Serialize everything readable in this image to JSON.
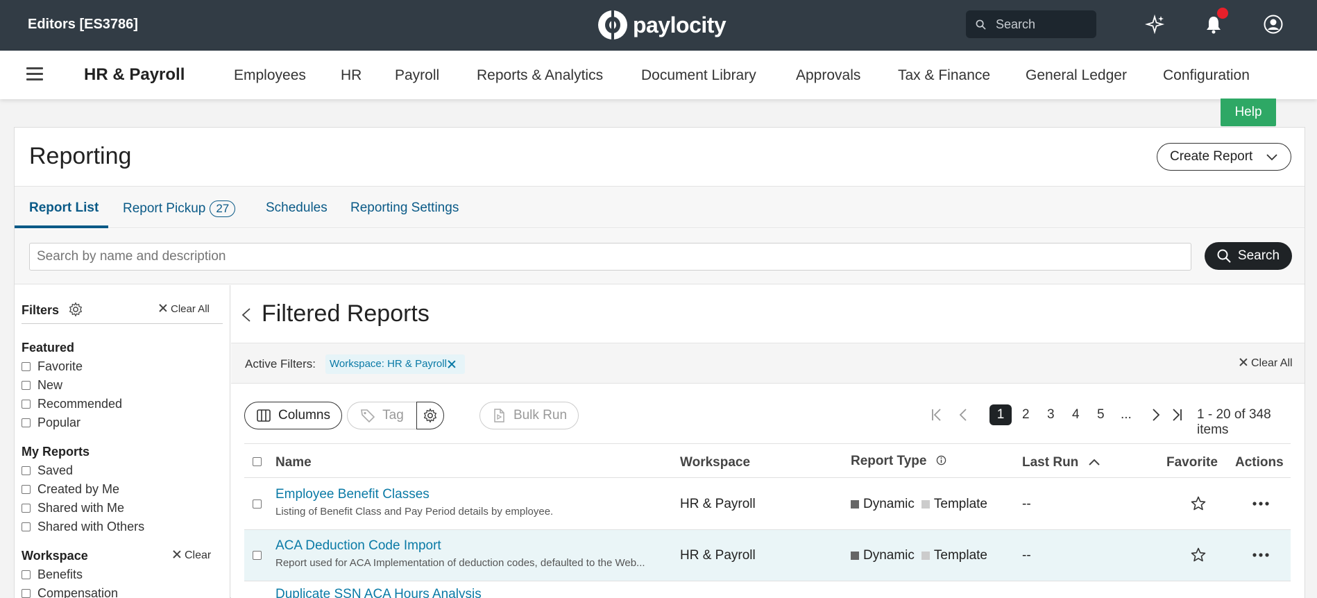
{
  "topbar": {
    "company": "Editors [ES3786]",
    "logo_text": "paylocity",
    "search_placeholder": "Search",
    "icons": [
      "sparkle-icon",
      "bell-icon",
      "user-icon"
    ]
  },
  "navbar": {
    "product": "HR & Payroll",
    "items": [
      "Employees",
      "HR",
      "Payroll",
      "Reports & Analytics",
      "Document Library",
      "Approvals",
      "Tax & Finance",
      "General Ledger",
      "Configuration"
    ]
  },
  "help_label": "Help",
  "page": {
    "title": "Reporting",
    "create_report": "Create Report"
  },
  "tabs": [
    {
      "label": "Report List",
      "active": true
    },
    {
      "label": "Report Pickup",
      "badge": "27"
    },
    {
      "label": "Schedules"
    },
    {
      "label": "Reporting Settings"
    }
  ],
  "search": {
    "placeholder": "Search by name and description",
    "button": "Search"
  },
  "filters": {
    "title": "Filters",
    "clear_all": "Clear All",
    "featured": {
      "title": "Featured",
      "options": [
        "Favorite",
        "New",
        "Recommended",
        "Popular"
      ]
    },
    "my_reports": {
      "title": "My Reports",
      "options": [
        "Saved",
        "Created by Me",
        "Shared with Me",
        "Shared with Others"
      ]
    },
    "workspace": {
      "title": "Workspace",
      "clear": "Clear",
      "options": [
        "Benefits",
        "Compensation"
      ]
    }
  },
  "content": {
    "title": "Filtered Reports",
    "active_filters_label": "Active Filters:",
    "chip": "Workspace: HR & Payroll",
    "clear_all": "Clear All"
  },
  "toolbar": {
    "columns": "Columns",
    "tag": "Tag",
    "bulk_run": "Bulk Run",
    "pages": [
      "1",
      "2",
      "3",
      "4",
      "5",
      "..."
    ],
    "current_page": "1",
    "count": "1 - 20 of 348 items"
  },
  "table": {
    "headers": {
      "name": "Name",
      "workspace": "Workspace",
      "report_type": "Report Type",
      "last_run": "Last Run",
      "favorite": "Favorite",
      "actions": "Actions"
    },
    "rows": [
      {
        "name": "Employee Benefit Classes",
        "desc": "Listing of Benefit Class and Pay Period details by employee.",
        "workspace": "HR & Payroll",
        "type1": "Dynamic",
        "type2": "Template",
        "last_run": "--"
      },
      {
        "name": "ACA Deduction Code Import",
        "desc": "Report used for ACA Implementation of deduction codes, defaulted to the Web...",
        "workspace": "HR & Payroll",
        "type1": "Dynamic",
        "type2": "Template",
        "last_run": "--"
      },
      {
        "name": "Duplicate SSN ACA Hours Analysis"
      }
    ]
  },
  "colors": {
    "topbar": "#323c45",
    "link": "#0a7aa6",
    "help": "#2ea865",
    "highlight_row": "#eaf5f7"
  }
}
